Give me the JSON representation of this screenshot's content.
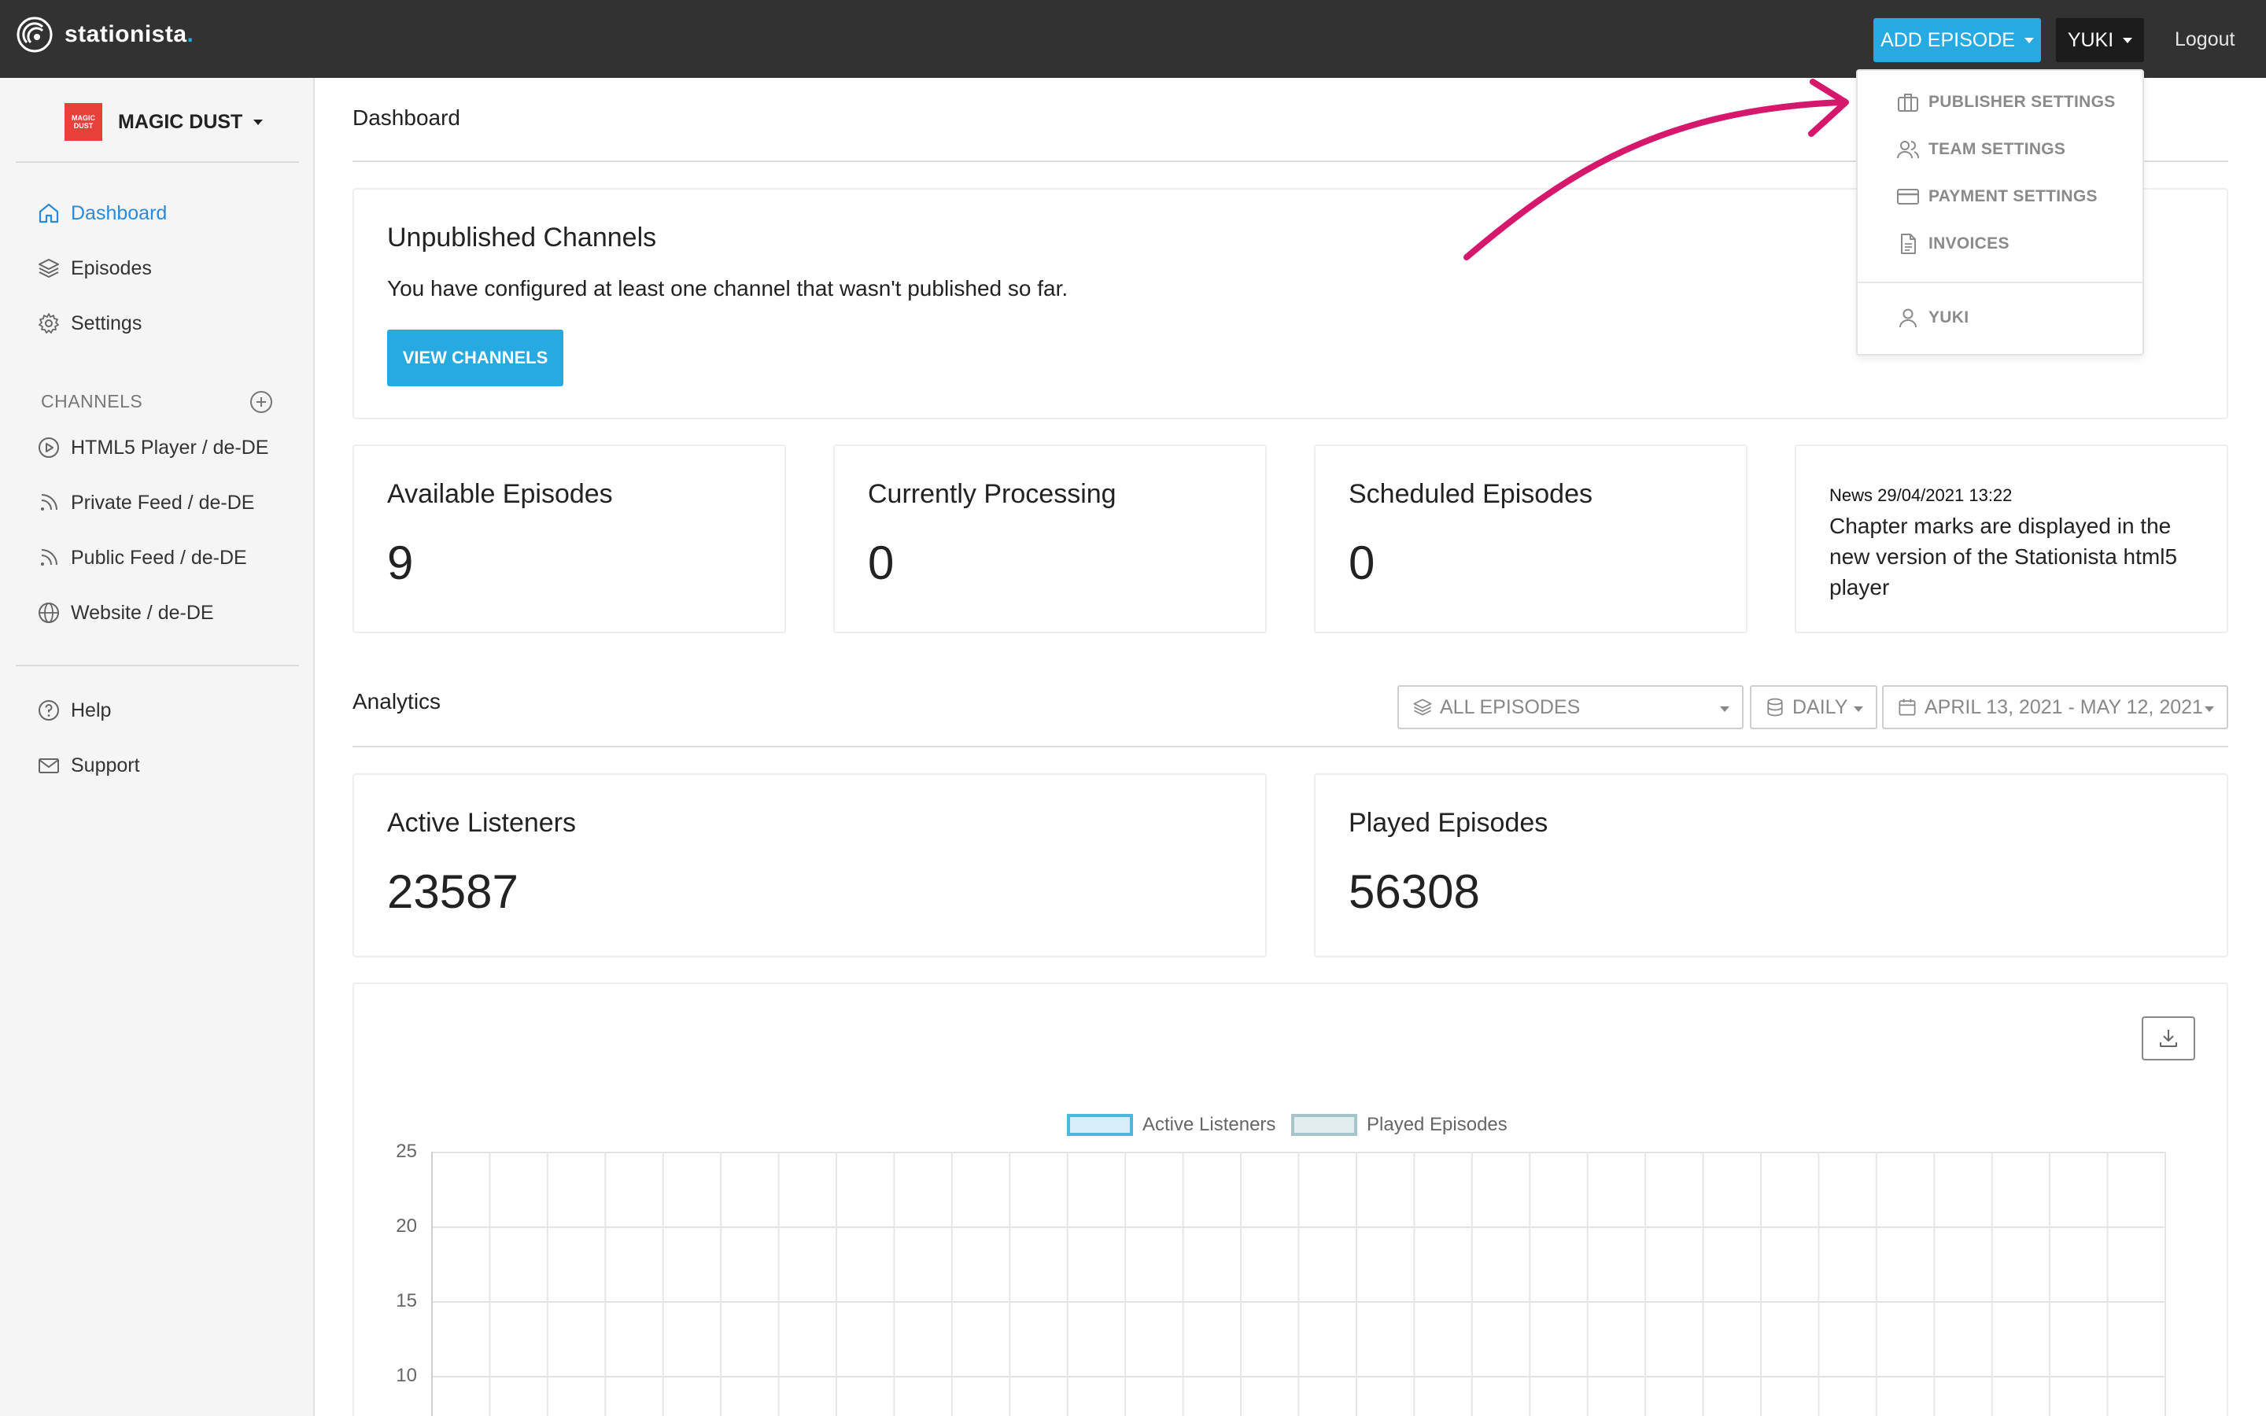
{
  "app": {
    "name": "stationista",
    "name_dot": ".",
    "add_episode_label": "ADD EPISODE",
    "user_label": "YUKI",
    "logout_label": "Logout"
  },
  "sidebar": {
    "workspace_name": "MAGIC DUST",
    "workspace_logo_text": [
      "MAGIC",
      "DUST"
    ],
    "nav": [
      {
        "label": "Dashboard",
        "icon": "home-icon",
        "active": true
      },
      {
        "label": "Episodes",
        "icon": "layers-icon"
      },
      {
        "label": "Settings",
        "icon": "gear-icon"
      }
    ],
    "channels_heading": "CHANNELS",
    "channels": [
      {
        "label": "HTML5 Player / de-DE",
        "icon": "play-circle-icon"
      },
      {
        "label": "Private Feed / de-DE",
        "icon": "rss-icon"
      },
      {
        "label": "Public Feed / de-DE",
        "icon": "rss-icon"
      },
      {
        "label": "Website / de-DE",
        "icon": "globe-icon"
      }
    ],
    "bottom": [
      {
        "label": "Help",
        "icon": "help-circle-icon"
      },
      {
        "label": "Support",
        "icon": "mail-icon"
      }
    ]
  },
  "main": {
    "page_title": "Dashboard",
    "unpublished": {
      "title": "Unpublished Channels",
      "text": "You have configured at least one channel that wasn't published so far.",
      "button": "VIEW CHANNELS"
    },
    "stats": [
      {
        "title": "Available Episodes",
        "value": "9"
      },
      {
        "title": "Currently Processing",
        "value": "0"
      },
      {
        "title": "Scheduled Episodes",
        "value": "0"
      }
    ],
    "news": {
      "meta": "News 29/04/2021 13:22",
      "body": "Chapter marks are displayed in the new version of the Stationista html5 player"
    },
    "analytics": {
      "title": "Analytics",
      "filter_episodes": "ALL EPISODES",
      "filter_interval": "DAILY",
      "filter_range": "APRIL 13, 2021 - MAY 12, 2021",
      "active_listeners_title": "Active Listeners",
      "active_listeners_value": "23587",
      "played_episodes_title": "Played Episodes",
      "played_episodes_value": "56308"
    }
  },
  "dropdown": {
    "items": [
      {
        "label": "PUBLISHER SETTINGS",
        "icon": "briefcase-icon"
      },
      {
        "label": "TEAM SETTINGS",
        "icon": "users-icon"
      },
      {
        "label": "PAYMENT SETTINGS",
        "icon": "credit-card-icon"
      },
      {
        "label": "INVOICES",
        "icon": "file-text-icon"
      },
      {
        "label": "YUKI",
        "icon": "user-icon"
      }
    ]
  },
  "colors": {
    "topbar": "#323232",
    "accent": "#27a9e1",
    "active_nav": "#2a8ad8",
    "annotation_arrow": "#d6186c",
    "legend_active": "#4db8dd",
    "legend_played": "#a6c4cc"
  },
  "chart_data": {
    "type": "line",
    "legend": [
      "Active Listeners",
      "Played Episodes"
    ],
    "series": [
      {
        "name": "Active Listeners",
        "values": []
      },
      {
        "name": "Played Episodes",
        "values": []
      }
    ],
    "yticks": [
      25,
      20,
      15,
      10
    ],
    "ylim": [
      10,
      25
    ],
    "grid": true,
    "legend_position": "top-center",
    "x_gridlines": 30
  }
}
